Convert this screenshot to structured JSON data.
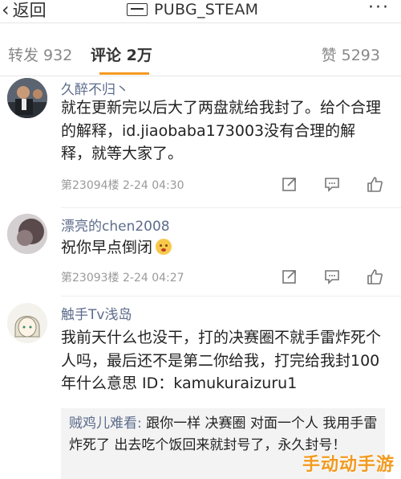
{
  "header": {
    "back_label": "返回",
    "title": "PUBG_STEAM"
  },
  "tabs": {
    "repost_label": "转发 932",
    "comment_label": "评论 2万",
    "like_label": "赞 5293"
  },
  "comments": [
    {
      "name": "久醉不归丶",
      "text": "就在更新完以后大了两盘就给我封了。给个合理的解释，id.jiaobaba173003没有合理的解释，就等大家了。",
      "meta": "第23094楼 2-24 04:30"
    },
    {
      "name": "漂亮的chen2008",
      "text": "祝你早点倒闭",
      "meta": "第23093楼 2-24 04:27"
    },
    {
      "name": "触手Tv浅岛",
      "text": "我前天什么也没干，打的决赛圈不就手雷炸死个人吗，最后还不是第二你给我，打完给我封100年什么意思  ID：kamukuraizuru1"
    }
  ],
  "reply": {
    "author": "贼鸡儿难看:",
    "text": " 跟你一样  决赛圈 对面一个人 我用手雷炸死了   出去吃个饭回来就封号了，永久封号！"
  },
  "watermark": "手动动手游",
  "icons": [
    "back-chevron-icon",
    "feed-badge-icon",
    "more-dots-icon",
    "repost-icon",
    "reply-icon",
    "like-icon"
  ],
  "colors": {
    "accent": "#f59a23",
    "username": "#5d6c8c",
    "meta": "#9a9a9a"
  }
}
